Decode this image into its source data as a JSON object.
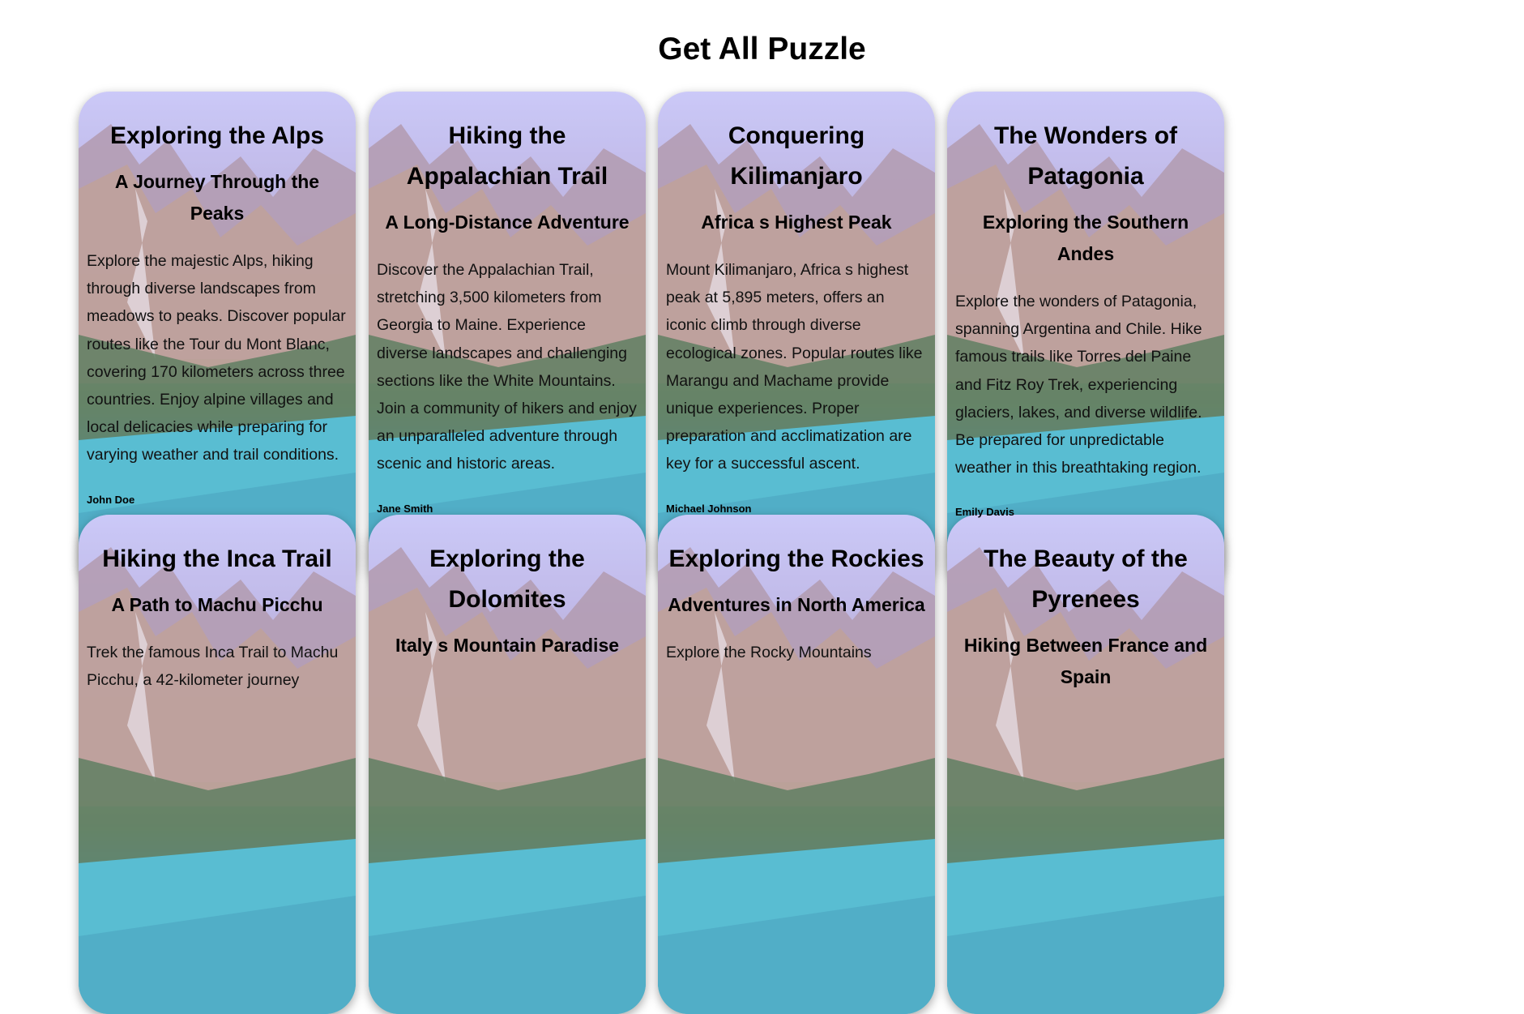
{
  "page": {
    "title": "Get All Puzzle"
  },
  "cards": [
    {
      "title": "Exploring the Alps",
      "subtitle": "A Journey Through the Peaks",
      "description": "Explore the majestic Alps, hiking through diverse landscapes from meadows to peaks. Discover popular routes like the Tour du Mont Blanc, covering 170 kilometers across three countries. Enjoy alpine villages and local delicacies while preparing for varying weather and trail conditions.",
      "author": "John Doe"
    },
    {
      "title": "Hiking the Appalachian Trail",
      "subtitle": "A Long-Distance Adventure",
      "description": "Discover the Appalachian Trail, stretching 3,500 kilometers from Georgia to Maine. Experience diverse landscapes and challenging sections like the White Mountains. Join a community of hikers and enjoy an unparalleled adventure through scenic and historic areas.",
      "author": "Jane Smith"
    },
    {
      "title": "Conquering Kilimanjaro",
      "subtitle": "Africa s Highest Peak",
      "description": "Mount Kilimanjaro, Africa s highest peak at 5,895 meters, offers an iconic climb through diverse ecological zones. Popular routes like Marangu and Machame provide unique experiences. Proper preparation and acclimatization are key for a successful ascent.",
      "author": "Michael Johnson"
    },
    {
      "title": "The Wonders of Patagonia",
      "subtitle": "Exploring the Southern Andes",
      "description": "Explore the wonders of Patagonia, spanning Argentina and Chile. Hike famous trails like Torres del Paine and Fitz Roy Trek, experiencing glaciers, lakes, and diverse wildlife. Be prepared for unpredictable weather in this breathtaking region.",
      "author": "Emily Davis"
    },
    {
      "title": "Hiking the Inca Trail",
      "subtitle": "A Path to Machu Picchu",
      "description": "Trek the famous Inca Trail to Machu Picchu, a 42-kilometer journey",
      "author": ""
    },
    {
      "title": "Exploring the Dolomites",
      "subtitle": "Italy s Mountain Paradise",
      "description": "",
      "author": ""
    },
    {
      "title": "Exploring the Rockies",
      "subtitle": "Adventures in North America",
      "description": "Explore the Rocky Mountains",
      "author": ""
    },
    {
      "title": "The Beauty of the Pyrenees",
      "subtitle": "Hiking Between France and Spain",
      "description": "",
      "author": ""
    }
  ],
  "colors": {
    "sky_top": "#b7b8f4",
    "mountain": "#9c8ab0",
    "rock": "#c9a48f",
    "forest": "#3e6a4c",
    "lake": "#3fb2c8",
    "lake_deep": "#2b8fb0"
  }
}
